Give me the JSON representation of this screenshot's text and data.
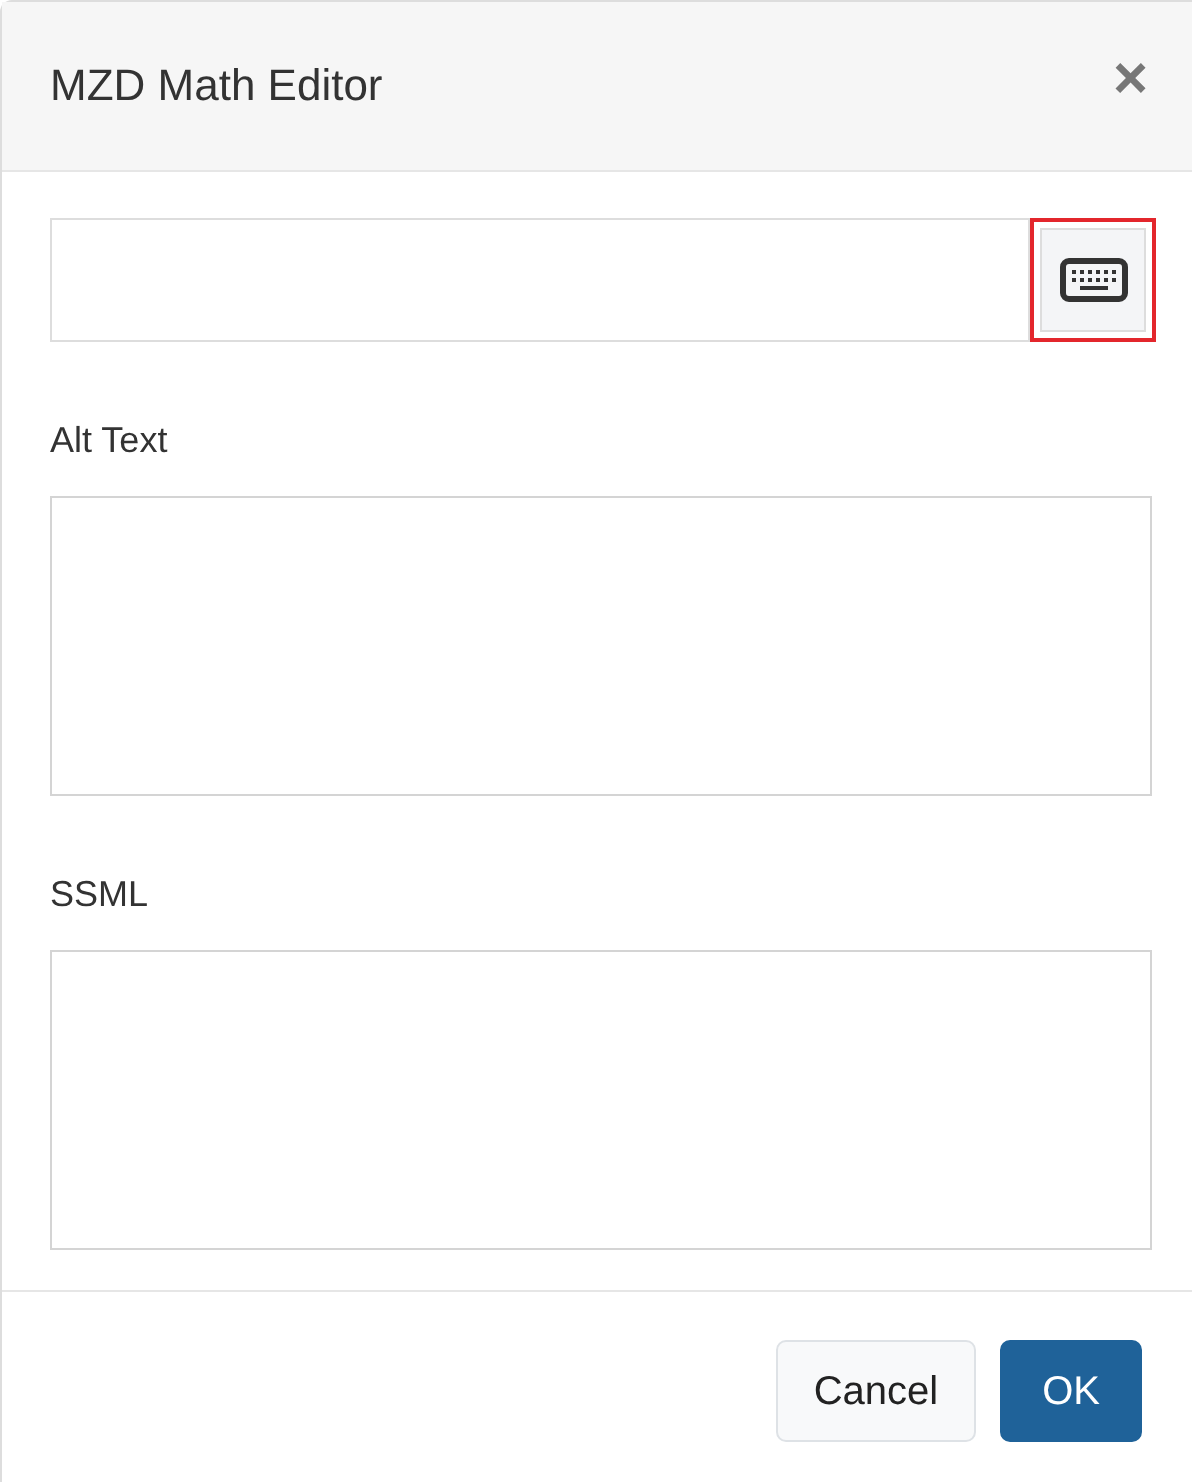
{
  "dialog": {
    "title": "MZD Math Editor",
    "close": "×"
  },
  "math_input": {
    "keyboard_button": {
      "focused": true
    }
  },
  "fields": [
    {
      "label": "Alt Text"
    },
    {
      "label": "SSML"
    }
  ],
  "buttons": [
    {
      "label": "Cancel",
      "kind": "secondary"
    },
    {
      "label": "OK",
      "kind": "primary"
    }
  ]
}
